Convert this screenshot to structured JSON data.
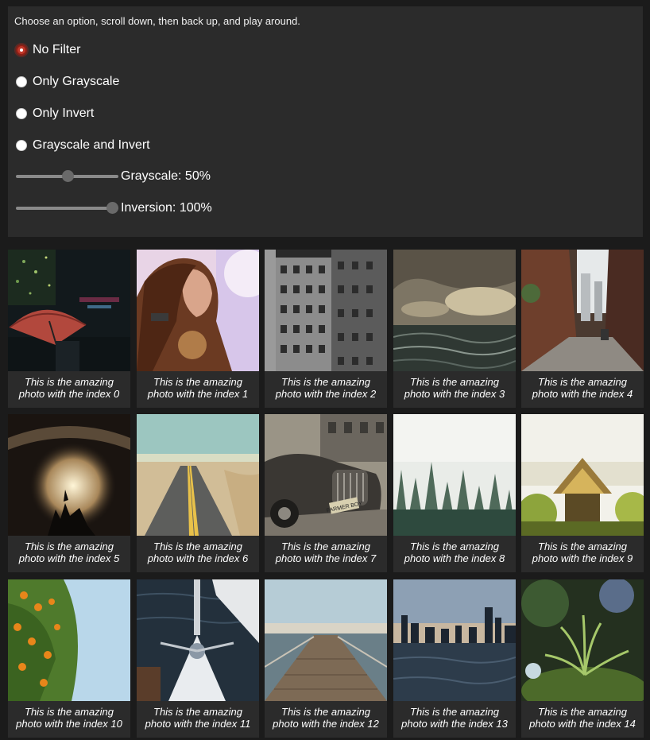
{
  "instructions": "Choose an option, scroll down, then back up, and play around.",
  "filter_options": [
    {
      "label": "No Filter",
      "checked": true
    },
    {
      "label": "Only Grayscale",
      "checked": false
    },
    {
      "label": "Only Invert",
      "checked": false
    },
    {
      "label": "Grayscale and Invert",
      "checked": false
    }
  ],
  "sliders": {
    "grayscale": {
      "label": "Grayscale: 50%",
      "value": 50
    },
    "inversion": {
      "label": "Inversion: 100%",
      "value": 100
    }
  },
  "photos": [
    {
      "caption_line1": "This is the amazing",
      "caption_line2": "photo with the index 0"
    },
    {
      "caption_line1": "This is the amazing",
      "caption_line2": "photo with the index 1"
    },
    {
      "caption_line1": "This is the amazing",
      "caption_line2": "photo with the index 2"
    },
    {
      "caption_line1": "This is the amazing",
      "caption_line2": "photo with the index 3"
    },
    {
      "caption_line1": "This is the amazing",
      "caption_line2": "photo with the index 4"
    },
    {
      "caption_line1": "This is the amazing",
      "caption_line2": "photo with the index 5"
    },
    {
      "caption_line1": "This is the amazing",
      "caption_line2": "photo with the index 6"
    },
    {
      "caption_line1": "This is the amazing",
      "caption_line2": "photo with the index 7"
    },
    {
      "caption_line1": "This is the amazing",
      "caption_line2": "photo with the index 8"
    },
    {
      "caption_line1": "This is the amazing",
      "caption_line2": "photo with the index 9"
    },
    {
      "caption_line1": "This is the amazing",
      "caption_line2": "photo with the index 10"
    },
    {
      "caption_line1": "This is the amazing",
      "caption_line2": "photo with the index 11"
    },
    {
      "caption_line1": "This is the amazing",
      "caption_line2": "photo with the index 12"
    },
    {
      "caption_line1": "This is the amazing",
      "caption_line2": "photo with the index 13"
    },
    {
      "caption_line1": "This is the amazing",
      "caption_line2": "photo with the index 14"
    }
  ],
  "photo_plate_text": "FARMER BOY",
  "colors": {
    "page_background": "#1b1b1b",
    "panel_background": "#2b2b2b",
    "radio_checked": "#c0392b"
  }
}
